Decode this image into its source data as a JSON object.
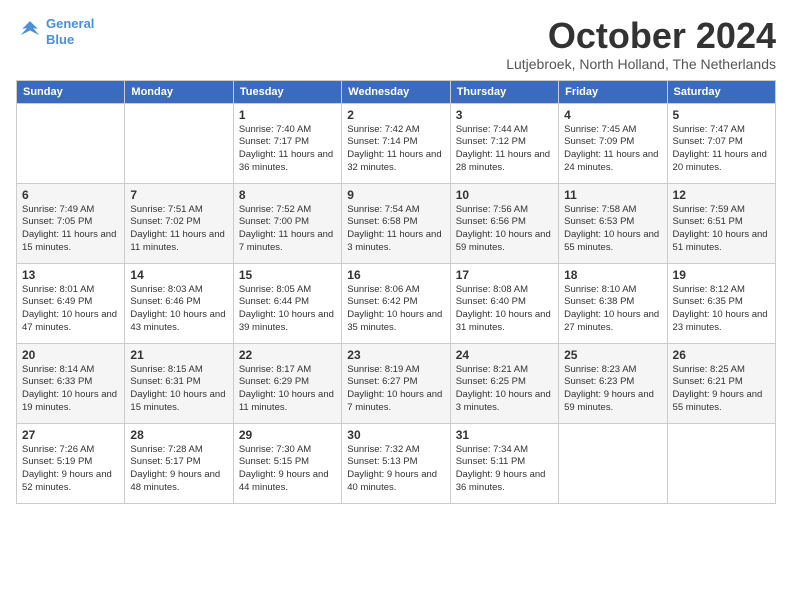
{
  "logo": {
    "line1": "General",
    "line2": "Blue"
  },
  "header": {
    "month": "October 2024",
    "location": "Lutjebroek, North Holland, The Netherlands"
  },
  "days_of_week": [
    "Sunday",
    "Monday",
    "Tuesday",
    "Wednesday",
    "Thursday",
    "Friday",
    "Saturday"
  ],
  "weeks": [
    [
      null,
      null,
      {
        "day": 1,
        "sunrise": "7:40 AM",
        "sunset": "7:17 PM",
        "daylight": "Daylight: 11 hours and 36 minutes."
      },
      {
        "day": 2,
        "sunrise": "7:42 AM",
        "sunset": "7:14 PM",
        "daylight": "Daylight: 11 hours and 32 minutes."
      },
      {
        "day": 3,
        "sunrise": "7:44 AM",
        "sunset": "7:12 PM",
        "daylight": "Daylight: 11 hours and 28 minutes."
      },
      {
        "day": 4,
        "sunrise": "7:45 AM",
        "sunset": "7:09 PM",
        "daylight": "Daylight: 11 hours and 24 minutes."
      },
      {
        "day": 5,
        "sunrise": "7:47 AM",
        "sunset": "7:07 PM",
        "daylight": "Daylight: 11 hours and 20 minutes."
      }
    ],
    [
      {
        "day": 6,
        "sunrise": "7:49 AM",
        "sunset": "7:05 PM",
        "daylight": "Daylight: 11 hours and 15 minutes."
      },
      {
        "day": 7,
        "sunrise": "7:51 AM",
        "sunset": "7:02 PM",
        "daylight": "Daylight: 11 hours and 11 minutes."
      },
      {
        "day": 8,
        "sunrise": "7:52 AM",
        "sunset": "7:00 PM",
        "daylight": "Daylight: 11 hours and 7 minutes."
      },
      {
        "day": 9,
        "sunrise": "7:54 AM",
        "sunset": "6:58 PM",
        "daylight": "Daylight: 11 hours and 3 minutes."
      },
      {
        "day": 10,
        "sunrise": "7:56 AM",
        "sunset": "6:56 PM",
        "daylight": "Daylight: 10 hours and 59 minutes."
      },
      {
        "day": 11,
        "sunrise": "7:58 AM",
        "sunset": "6:53 PM",
        "daylight": "Daylight: 10 hours and 55 minutes."
      },
      {
        "day": 12,
        "sunrise": "7:59 AM",
        "sunset": "6:51 PM",
        "daylight": "Daylight: 10 hours and 51 minutes."
      }
    ],
    [
      {
        "day": 13,
        "sunrise": "8:01 AM",
        "sunset": "6:49 PM",
        "daylight": "Daylight: 10 hours and 47 minutes."
      },
      {
        "day": 14,
        "sunrise": "8:03 AM",
        "sunset": "6:46 PM",
        "daylight": "Daylight: 10 hours and 43 minutes."
      },
      {
        "day": 15,
        "sunrise": "8:05 AM",
        "sunset": "6:44 PM",
        "daylight": "Daylight: 10 hours and 39 minutes."
      },
      {
        "day": 16,
        "sunrise": "8:06 AM",
        "sunset": "6:42 PM",
        "daylight": "Daylight: 10 hours and 35 minutes."
      },
      {
        "day": 17,
        "sunrise": "8:08 AM",
        "sunset": "6:40 PM",
        "daylight": "Daylight: 10 hours and 31 minutes."
      },
      {
        "day": 18,
        "sunrise": "8:10 AM",
        "sunset": "6:38 PM",
        "daylight": "Daylight: 10 hours and 27 minutes."
      },
      {
        "day": 19,
        "sunrise": "8:12 AM",
        "sunset": "6:35 PM",
        "daylight": "Daylight: 10 hours and 23 minutes."
      }
    ],
    [
      {
        "day": 20,
        "sunrise": "8:14 AM",
        "sunset": "6:33 PM",
        "daylight": "Daylight: 10 hours and 19 minutes."
      },
      {
        "day": 21,
        "sunrise": "8:15 AM",
        "sunset": "6:31 PM",
        "daylight": "Daylight: 10 hours and 15 minutes."
      },
      {
        "day": 22,
        "sunrise": "8:17 AM",
        "sunset": "6:29 PM",
        "daylight": "Daylight: 10 hours and 11 minutes."
      },
      {
        "day": 23,
        "sunrise": "8:19 AM",
        "sunset": "6:27 PM",
        "daylight": "Daylight: 10 hours and 7 minutes."
      },
      {
        "day": 24,
        "sunrise": "8:21 AM",
        "sunset": "6:25 PM",
        "daylight": "Daylight: 10 hours and 3 minutes."
      },
      {
        "day": 25,
        "sunrise": "8:23 AM",
        "sunset": "6:23 PM",
        "daylight": "Daylight: 9 hours and 59 minutes."
      },
      {
        "day": 26,
        "sunrise": "8:25 AM",
        "sunset": "6:21 PM",
        "daylight": "Daylight: 9 hours and 55 minutes."
      }
    ],
    [
      {
        "day": 27,
        "sunrise": "7:26 AM",
        "sunset": "5:19 PM",
        "daylight": "Daylight: 9 hours and 52 minutes."
      },
      {
        "day": 28,
        "sunrise": "7:28 AM",
        "sunset": "5:17 PM",
        "daylight": "Daylight: 9 hours and 48 minutes."
      },
      {
        "day": 29,
        "sunrise": "7:30 AM",
        "sunset": "5:15 PM",
        "daylight": "Daylight: 9 hours and 44 minutes."
      },
      {
        "day": 30,
        "sunrise": "7:32 AM",
        "sunset": "5:13 PM",
        "daylight": "Daylight: 9 hours and 40 minutes."
      },
      {
        "day": 31,
        "sunrise": "7:34 AM",
        "sunset": "5:11 PM",
        "daylight": "Daylight: 9 hours and 36 minutes."
      },
      null,
      null
    ]
  ]
}
